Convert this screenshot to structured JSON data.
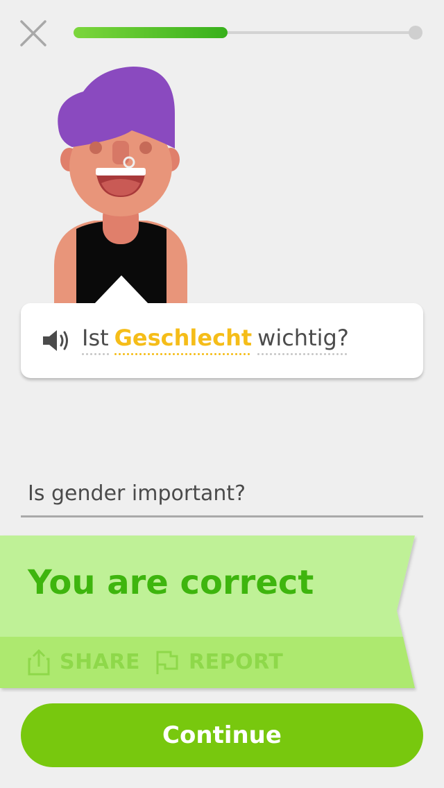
{
  "lesson": {
    "progress_fraction": 0.45
  },
  "prompt": {
    "words": [
      {
        "text": "Ist",
        "highlighted": false
      },
      {
        "text": "Geschlecht",
        "highlighted": true
      },
      {
        "text": "wichtig?",
        "highlighted": false
      }
    ]
  },
  "answer": {
    "value": "Is gender important?"
  },
  "result": {
    "title": "You are correct",
    "share_label": "SHARE",
    "report_label": "REPORT"
  },
  "footer": {
    "continue_label": "Continue"
  },
  "icons": {
    "close": "close-icon",
    "speaker": "speaker-icon",
    "share": "share-icon",
    "report": "flag-icon"
  },
  "colors": {
    "accent_green": "#78c80e",
    "correct_text": "#3eb50e",
    "banner_bg": "#bff197",
    "highlight_word": "#f5bd19",
    "hair_purple": "#8a4abf"
  }
}
